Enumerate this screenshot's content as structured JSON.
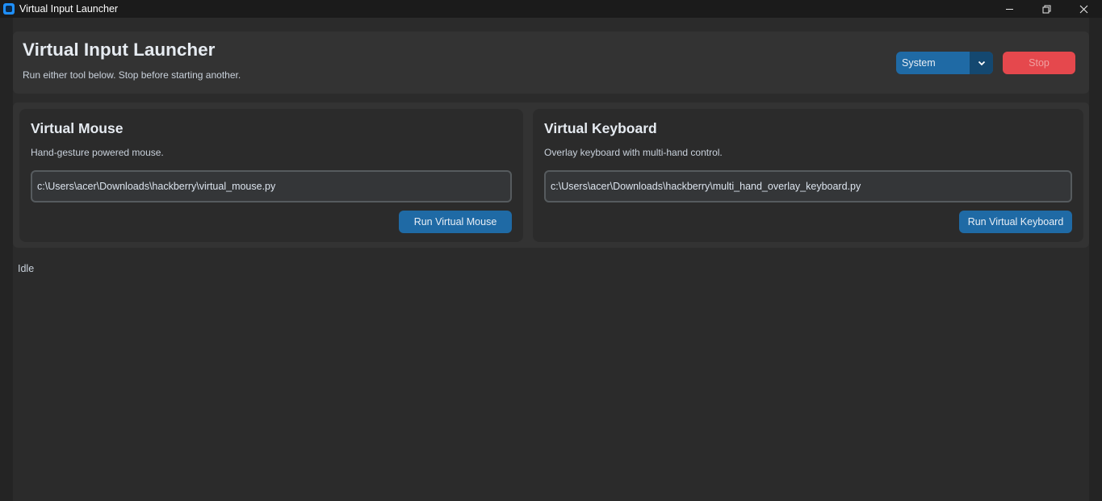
{
  "window": {
    "title": "Virtual Input Launcher"
  },
  "header": {
    "title": "Virtual Input Launcher",
    "subtitle": "Run either tool below. Stop before starting another.",
    "theme_value": "System",
    "stop_label": "Stop"
  },
  "tools": [
    {
      "title": "Virtual Mouse",
      "description": "Hand-gesture powered mouse.",
      "path": "c:\\Users\\acer\\Downloads\\hackberry\\virtual_mouse.py",
      "run_label": "Run Virtual Mouse"
    },
    {
      "title": "Virtual Keyboard",
      "description": "Overlay keyboard with multi-hand control.",
      "path": "c:\\Users\\acer\\Downloads\\hackberry\\multi_hand_overlay_keyboard.py",
      "run_label": "Run Virtual Keyboard"
    }
  ],
  "status": "Idle",
  "icons": {
    "app": "app-icon",
    "minimize": "minimize-icon",
    "maximize": "restore-icon",
    "close": "close-icon",
    "dropdown": "chevron-down-icon"
  },
  "colors": {
    "accent": "#1f6aa5",
    "accent_dark": "#144870",
    "stop": "#e5484d",
    "background": "#242424",
    "panel": "#333333",
    "card": "#2b2b2b"
  }
}
